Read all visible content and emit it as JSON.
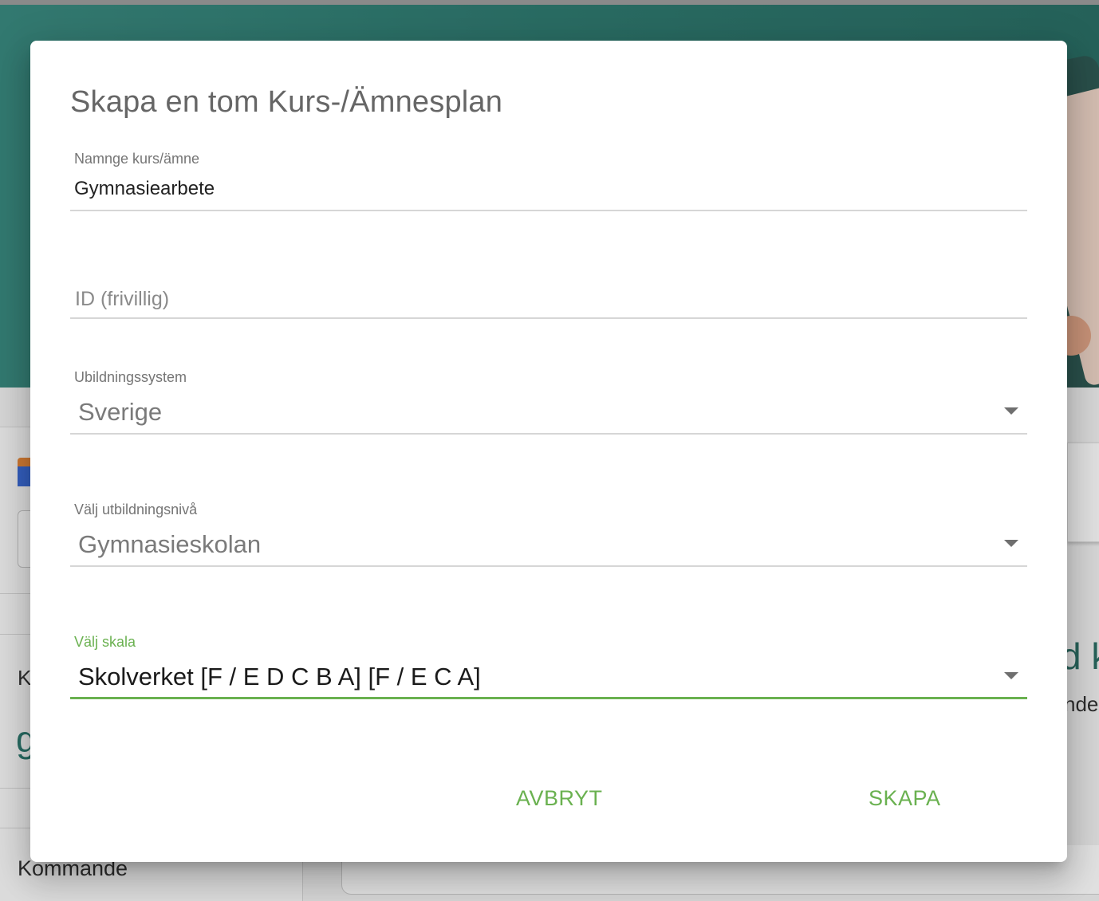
{
  "background": {
    "left_letter": "K",
    "left_large_letter": "g",
    "section_label": "Kommande",
    "right_heading_fragment": "d k",
    "right_sub_fragment": "nde"
  },
  "dialog": {
    "title": "Skapa en tom Kurs-/Ämnesplan",
    "fields": {
      "name": {
        "label": "Namnge kurs/ämne",
        "value": "Gymnasiearbete"
      },
      "id": {
        "placeholder": "ID (frivillig)"
      },
      "system": {
        "label": "Ubildningssystem",
        "value": "Sverige"
      },
      "level": {
        "label": "Välj utbildningsnivå",
        "value": "Gymnasieskolan"
      },
      "scale": {
        "label": "Välj skala",
        "value": "Skolverket [F / E D C B A] [F / E C A]"
      }
    },
    "actions": {
      "cancel": "AVBRYT",
      "create": "SKAPA"
    }
  },
  "colors": {
    "accent": "#6ab150",
    "hero": "#2f7a70"
  },
  "icons": {
    "dropdown": "caret-down-icon"
  }
}
